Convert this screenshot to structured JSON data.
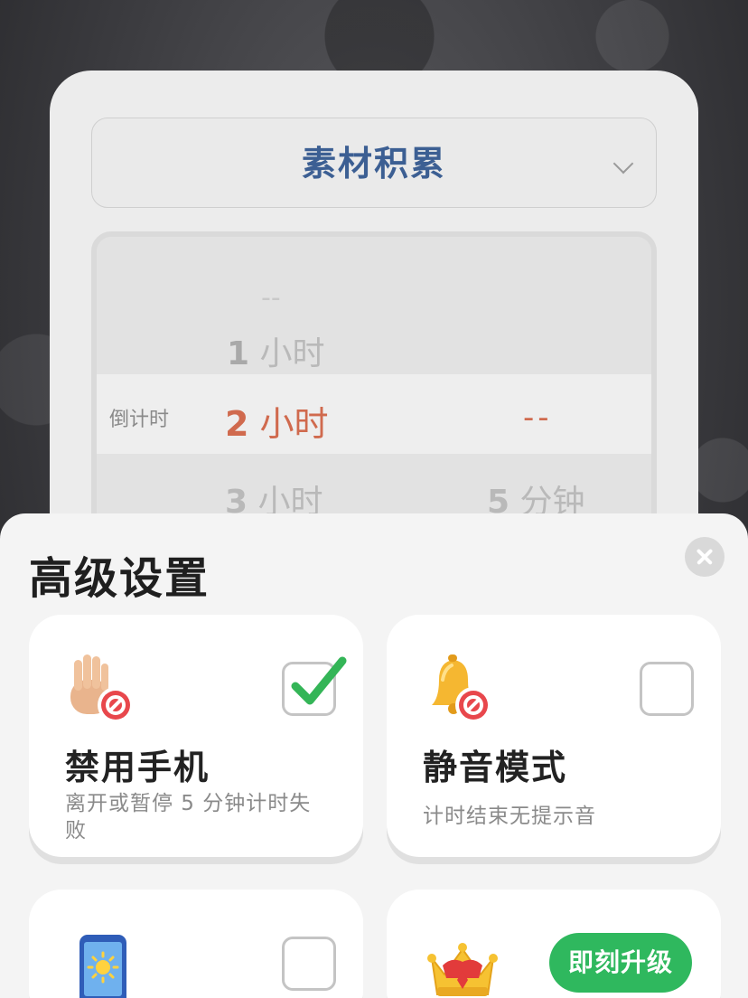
{
  "timer_card": {
    "task_name": "素材积累",
    "picker": {
      "top_placeholder": "--",
      "hour_prev_num": "1",
      "hour_prev_unit": " 小时",
      "mode_label": "倒计时",
      "hour_selected_num": "2",
      "hour_selected_unit": " 小时",
      "minute_selected": "--",
      "hour_next_num": "3",
      "hour_next_unit": " 小时",
      "minute_next_num": "5",
      "minute_next_unit": " 分钟"
    }
  },
  "sheet": {
    "title": "高级设置",
    "options": [
      {
        "title": "禁用手机",
        "description": "离开或暂停 5 分钟计时失败",
        "icon": "stop-hand-icon",
        "checked": true
      },
      {
        "title": "静音模式",
        "description": "计时结束无提示音",
        "icon": "muted-bell-icon",
        "checked": false
      },
      {
        "title": "",
        "description": "",
        "icon": "phone-brightness-icon",
        "checked": false
      },
      {
        "title": "",
        "description": "",
        "icon": "crown-icon",
        "button": "即刻升级"
      }
    ]
  },
  "colors": {
    "accent_green": "#2fb85e",
    "selected_orange": "#d06a4e",
    "task_blue": "#3c5f93"
  }
}
